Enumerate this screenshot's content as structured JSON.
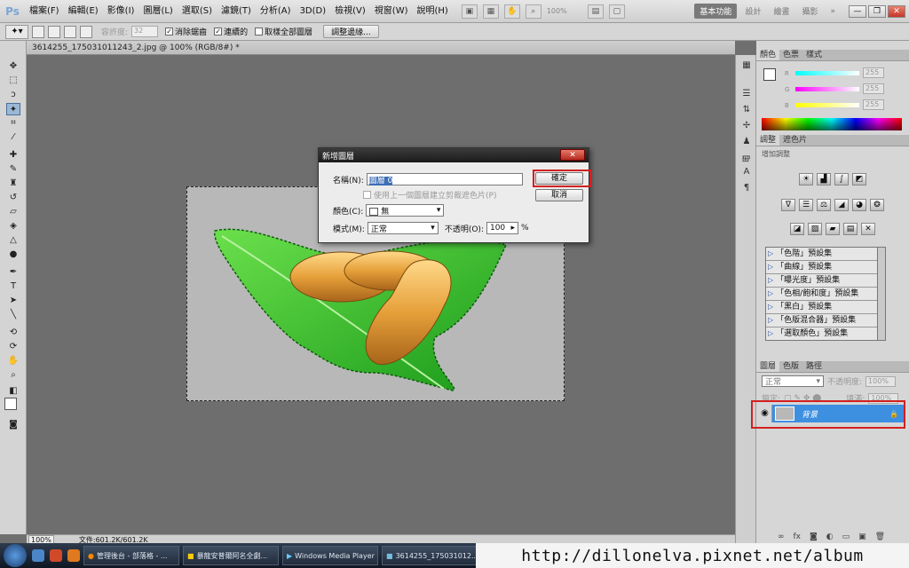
{
  "app": {
    "logo": "Ps",
    "menus": [
      "檔案(F)",
      "編輯(E)",
      "影像(I)",
      "圖層(L)",
      "選取(S)",
      "濾鏡(T)",
      "分析(A)",
      "3D(D)",
      "檢視(V)",
      "視窗(W)",
      "說明(H)"
    ],
    "zoom_display": "100%",
    "workspaces": {
      "active": "基本功能",
      "items": [
        "設計",
        "繪畫",
        "攝影"
      ],
      "more": "»"
    },
    "window_buttons": {
      "minimize": "—",
      "restore": "❐",
      "close": "✕"
    }
  },
  "options_bar": {
    "tolerance_label": "容許度:",
    "tolerance_value": "32",
    "anti_alias": "消除鋸齒",
    "contiguous": "連續的",
    "sample_all": "取樣全部圖層",
    "refine_button": "調整邊緣..."
  },
  "document": {
    "tab_title": "3614255_175031011243_2.jpg @ 100% (RGB/8#) *",
    "status_zoom": "100%",
    "status_doc": "文件:601.2K/601.2K"
  },
  "dialog": {
    "title": "新增圖層",
    "name_label": "名稱(N):",
    "name_value": "圖層 0",
    "clip_checkbox": "使用上一個圖層建立剪裁遮色片(P)",
    "color_label": "顏色(C):",
    "color_value": "無",
    "mode_label": "模式(M):",
    "mode_value": "正常",
    "opacity_label": "不透明(O):",
    "opacity_value": "100",
    "opacity_unit": "%",
    "ok_button": "確定",
    "cancel_button": "取消",
    "close": "✕"
  },
  "color_panel": {
    "tabs": [
      "顏色",
      "色票",
      "樣式"
    ],
    "sliders": [
      {
        "letter": "R",
        "value": "255"
      },
      {
        "letter": "G",
        "value": "255"
      },
      {
        "letter": "B",
        "value": "255"
      }
    ]
  },
  "adjust_panel": {
    "tabs": [
      "調整",
      "遮色片"
    ],
    "subtitle": "增加調整",
    "presets": [
      "「色階」預設集",
      "「曲線」預設集",
      "「曝光度」預設集",
      "「色相/飽和度」預設集",
      "「黑白」預設集",
      "「色版混合器」預設集",
      "「選取顏色」預設集"
    ]
  },
  "layers_panel": {
    "tabs": [
      "圖層",
      "色版",
      "路徑"
    ],
    "blend_mode": "正常",
    "opacity_label": "不透明度:",
    "opacity_value": "100%",
    "lock_label": "鎖定:",
    "fill_label": "填滿:",
    "fill_value": "100%",
    "layer_name": "背景"
  },
  "taskbar": {
    "items": [
      "管理後台 - 部落格 - ...",
      "暴龍安普爾阿名全劇...",
      "Windows Media Player",
      "3614255_175031012..."
    ]
  },
  "watermark": "http://dillonelva.pixnet.net/album",
  "colors": {
    "highlight_red": "#d32020",
    "layer_selected": "#3d8fe0"
  }
}
